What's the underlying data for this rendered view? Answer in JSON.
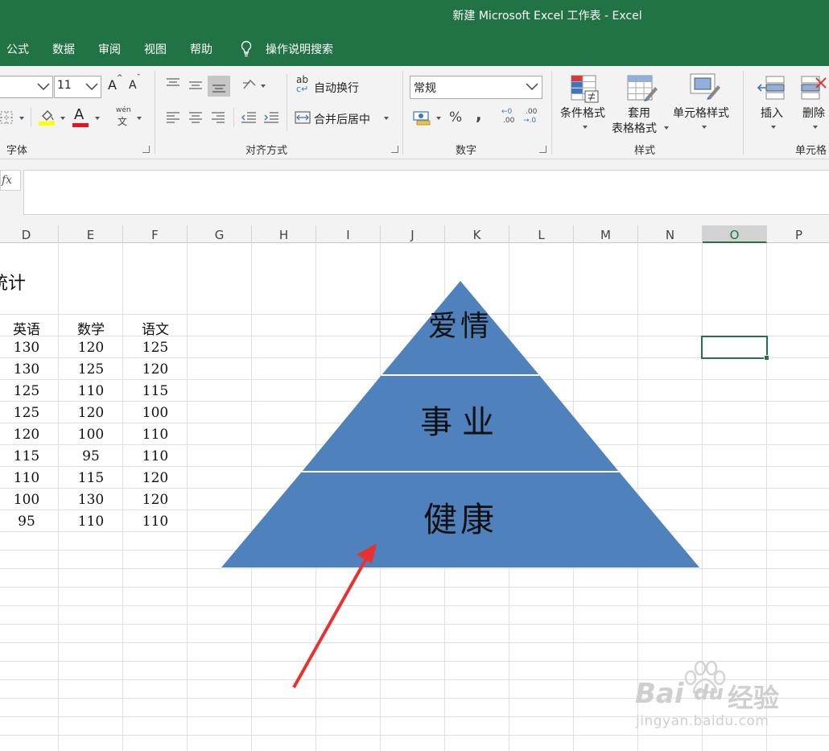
{
  "window": {
    "title": "新建 Microsoft Excel 工作表  -  Excel"
  },
  "menu": {
    "tabs": [
      "公式",
      "数据",
      "审阅",
      "视图",
      "帮助"
    ],
    "search_label": "操作说明搜索"
  },
  "ribbon": {
    "font": {
      "size": "11",
      "grow_label": "A",
      "shrink_label": "A",
      "color_label": "A",
      "phonetic_label": "wén",
      "phonetic_char": "文",
      "group_label": "字体"
    },
    "alignment": {
      "wrap_text": "自动换行",
      "merge_center": "合并后居中",
      "wrap_icon_top": "ab",
      "group_label": "对齐方式"
    },
    "number": {
      "format": "常规",
      "percent": "%",
      "comma": ",",
      "inc_decimal_top": "←0",
      "inc_decimal_bottom": ".00",
      "dec_decimal_top": ".00",
      "dec_decimal_bottom": "→.0",
      "group_label": "数字"
    },
    "styles": {
      "conditional": "条件格式",
      "table_format_1": "套用",
      "table_format_2": "表格格式",
      "cell_styles": "单元格样式",
      "group_label": "样式"
    },
    "cells": {
      "insert": "插入",
      "delete": "删除",
      "group_label": "单元格"
    }
  },
  "formula_bar": {
    "fx": "fx",
    "value": ""
  },
  "columns": [
    "D",
    "E",
    "F",
    "G",
    "H",
    "I",
    "J",
    "K",
    "L",
    "M",
    "N",
    "O",
    "P"
  ],
  "selected_column": "O",
  "sheet": {
    "title_fragment": "统计",
    "headers": [
      "英语",
      "数学",
      "语文"
    ],
    "rows": [
      [
        "130",
        "120",
        "125"
      ],
      [
        "130",
        "125",
        "120"
      ],
      [
        "125",
        "110",
        "115"
      ],
      [
        "125",
        "120",
        "100"
      ],
      [
        "120",
        "100",
        "110"
      ],
      [
        "115",
        "95",
        "110"
      ],
      [
        "110",
        "115",
        "120"
      ],
      [
        "100",
        "130",
        "120"
      ],
      [
        "95",
        "110",
        "110"
      ]
    ]
  },
  "pyramid": {
    "levels": [
      "爱情",
      "事业",
      "健康"
    ],
    "fill": "#4f81bd",
    "text_color": "#111111"
  },
  "colors": {
    "excel_green": "#217346",
    "arrow_red": "#e8322f"
  },
  "watermark": {
    "brand": "Bai",
    "brand2": "du",
    "suffix": "经验",
    "url": "jingyan.baidu.com"
  }
}
